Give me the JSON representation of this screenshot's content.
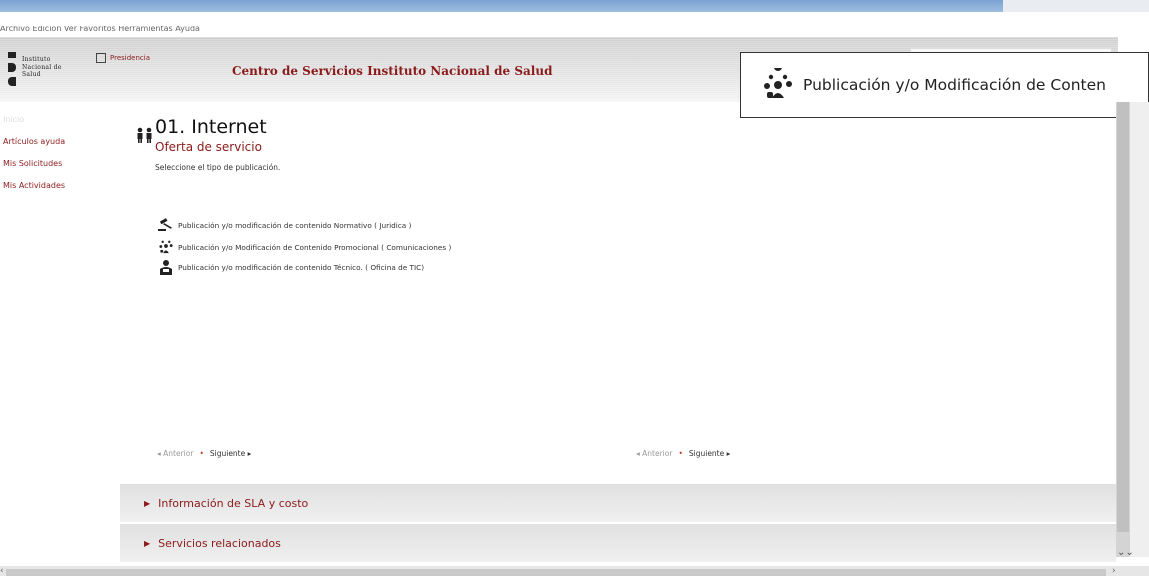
{
  "browser": {
    "menu": "Archivo   Edición   Ver   Favoritos   Herramientas   Ayuda"
  },
  "header": {
    "logo_lines": [
      "Instituto",
      "Nacional de",
      "Salud"
    ],
    "presidencia": "Presidencia",
    "title": "Centro de Servicios Instituto Nacional de Salud"
  },
  "tooltip": {
    "text": "Publicación y/o Modificación de Conten"
  },
  "sidebar": {
    "items": [
      {
        "label": "Inicio"
      },
      {
        "label": "Artículos ayuda"
      },
      {
        "label": "Mis Solicitudes"
      },
      {
        "label": "Mis Actividades"
      }
    ]
  },
  "main": {
    "title": "01. Internet",
    "subtitle": "Oferta de servicio",
    "instruction": "Seleccione el tipo de publicación.",
    "options": [
      {
        "label": "Publicación y/o modificación de contenido Normativo ( Juridica )",
        "icon": "gavel-icon"
      },
      {
        "label": "Publicación y/o Modificación de Contenido Promocional ( Comunicaciones )",
        "icon": "people-network-icon"
      },
      {
        "label": "Publicación y/o modificación de contenido Técnico. ( Oficina de TIC)",
        "icon": "technician-icon"
      }
    ]
  },
  "pager": {
    "prev": "◂ Anterior",
    "dot": "•",
    "next": "Siguiente ▸"
  },
  "accordions": [
    {
      "label": "Información de SLA y costo"
    },
    {
      "label": "Servicios relacionados"
    }
  ],
  "colors": {
    "brand": "#8b1a1a",
    "accent_dot": "#c0392b"
  }
}
